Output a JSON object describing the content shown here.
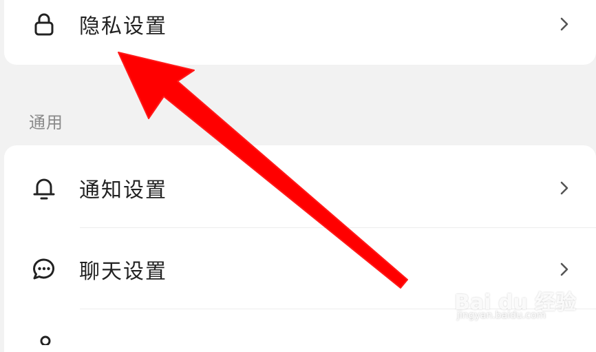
{
  "top_card": {
    "privacy": {
      "label": "隐私设置",
      "icon": "lock-icon"
    }
  },
  "general": {
    "header": "通用",
    "items": [
      {
        "label": "通知设置",
        "icon": "bell-icon"
      },
      {
        "label": "聊天设置",
        "icon": "chat-bubble-icon"
      }
    ]
  },
  "watermark": {
    "brand": "Bai du 经验",
    "url": "jingyan.baidu.com"
  },
  "colors": {
    "background": "#f2f2f2",
    "card": "#ffffff",
    "annotation_arrow": "#ff0000",
    "section_header": "#8a8a8a"
  }
}
